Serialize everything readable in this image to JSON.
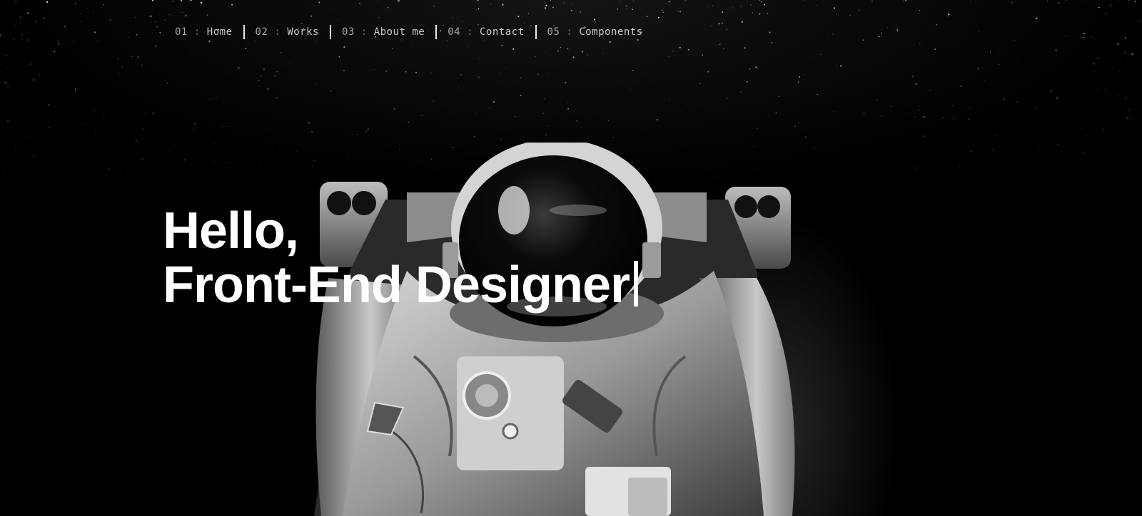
{
  "nav": {
    "items": [
      {
        "number": "01",
        "separator": ":",
        "label": "Home"
      },
      {
        "number": "02",
        "separator": ":",
        "label": "Works"
      },
      {
        "number": "03",
        "separator": ":",
        "label": "About me"
      },
      {
        "number": "04",
        "separator": ":",
        "label": "Contact"
      },
      {
        "number": "05",
        "separator": ":",
        "label": "Components"
      }
    ]
  },
  "hero": {
    "line1": "Hello,",
    "line2": "Front-End Designer"
  },
  "colors": {
    "background": "#000000",
    "text": "#ffffff",
    "nav_text": "#c9c9c9",
    "nav_separator": "#e8e8e8"
  },
  "icons": {
    "hero_image": "astronaut-image",
    "typing_cursor": "text-cursor-icon"
  }
}
